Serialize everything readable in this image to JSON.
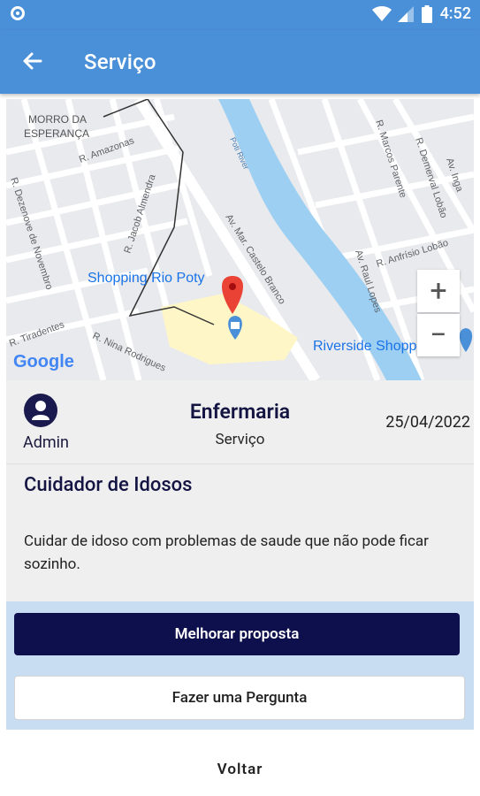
{
  "status_bar": {
    "time": "4:52"
  },
  "app_bar": {
    "title": "Serviço"
  },
  "map": {
    "places": {
      "morro_line1": "MORRO DA",
      "morro_line2": "ESPERANÇA",
      "shopping_rio_poty": "Shopping Rio Poty",
      "riverside": "Riverside Shopping",
      "poti_river": "Poti River"
    },
    "streets": {
      "amazonas": "R. Amazonas",
      "dezenove": "R. Dezenove de Novembro",
      "jacob": "R. Jacob Almendra",
      "castelo": "Av. Mar. Castelo Branco",
      "marcos": "R. Marcos Parente",
      "demerval": "R. Demerval Lobão",
      "inga": "Av. Inga",
      "anfrisio": "R. Anfrísio Lobão",
      "raul": "Av. Raul Lopes",
      "tiradentes": "R. Tiradentes",
      "nina": "R. Nina Rodrigues"
    },
    "google_label": "Google",
    "zoom_in": "+",
    "zoom_out": "−"
  },
  "card": {
    "user": "Admin",
    "title": "Enfermaria",
    "subtitle": "Serviço",
    "date": "25/04/2022",
    "service_title": "Cuidador de Idosos",
    "description": "Cuidar de idoso com problemas de saude que não pode ficar sozinho."
  },
  "actions": {
    "primary": "Melhorar proposta",
    "secondary": "Fazer uma Pergunta",
    "back": "Voltar"
  },
  "colors": {
    "app_bar": "#4a90d9",
    "primary_button": "#0e0f4d",
    "actions_background": "#c8dcf2"
  }
}
